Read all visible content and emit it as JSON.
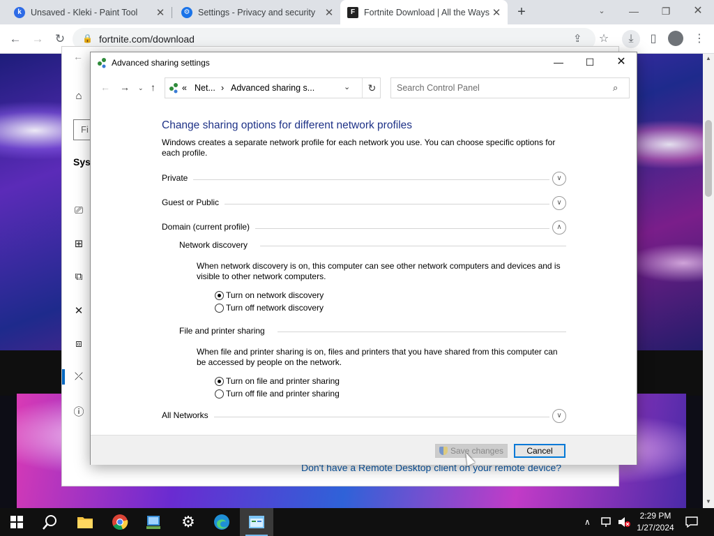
{
  "browser": {
    "tabs": [
      {
        "title": "Unsaved - Kleki - Paint Tool",
        "favicon": "kleki-icon",
        "color": "#2e6be6"
      },
      {
        "title": "Settings - Privacy and security",
        "favicon": "gear-icon",
        "color": "#1a73e8"
      },
      {
        "title": "Fortnite Download | All the Ways",
        "favicon": "fortnite-icon",
        "color": "#222222"
      }
    ],
    "url": "fortnite.com/download"
  },
  "webpage": {
    "settings_find": "Fi",
    "settings_system": "Syst",
    "remote_link": "Don't have a Remote Desktop client on your remote device?"
  },
  "dialog": {
    "title": "Advanced sharing settings",
    "breadcrumb": {
      "prefix": "«",
      "item1": "Net...",
      "item2": "Advanced sharing s..."
    },
    "search_placeholder": "Search Control Panel",
    "heading": "Change sharing options for different network profiles",
    "description": "Windows creates a separate network profile for each network you use. You can choose specific options for each profile.",
    "sections": {
      "private": "Private",
      "guest": "Guest or Public",
      "domain": "Domain (current profile)",
      "all": "All Networks"
    },
    "network_discovery": {
      "title": "Network discovery",
      "text": "When network discovery is on, this computer can see other network computers and devices and is visible to other network computers.",
      "on": "Turn on network discovery",
      "off": "Turn off network discovery"
    },
    "file_sharing": {
      "title": "File and printer sharing",
      "text": "When file and printer sharing is on, files and printers that you have shared from this computer can be accessed by people on the network.",
      "on": "Turn on file and printer sharing",
      "off": "Turn off file and printer sharing"
    },
    "buttons": {
      "save": "Save changes",
      "cancel": "Cancel"
    }
  },
  "taskbar": {
    "time": "2:29 PM",
    "date": "1/27/2024"
  }
}
